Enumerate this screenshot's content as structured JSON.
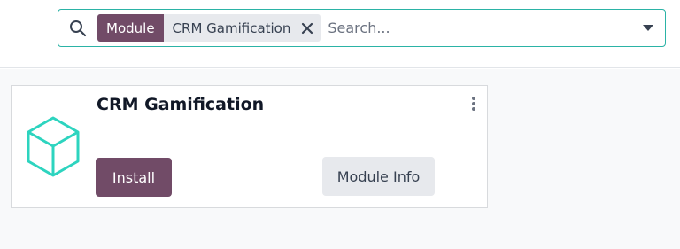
{
  "search": {
    "facet_label": "Module",
    "facet_value": "CRM Gamification",
    "placeholder": "Search..."
  },
  "icons": {
    "search": "search-icon",
    "remove": "close-icon",
    "dropdown": "caret-down-icon",
    "module": "cube-icon",
    "more": "kebab-vertical-icon"
  },
  "colors": {
    "brand": "#714b67",
    "accent": "#2bb3a6",
    "module_icon": "#2dd4bf"
  },
  "card": {
    "title": "CRM Gamification",
    "install_label": "Install",
    "info_label": "Module Info"
  }
}
